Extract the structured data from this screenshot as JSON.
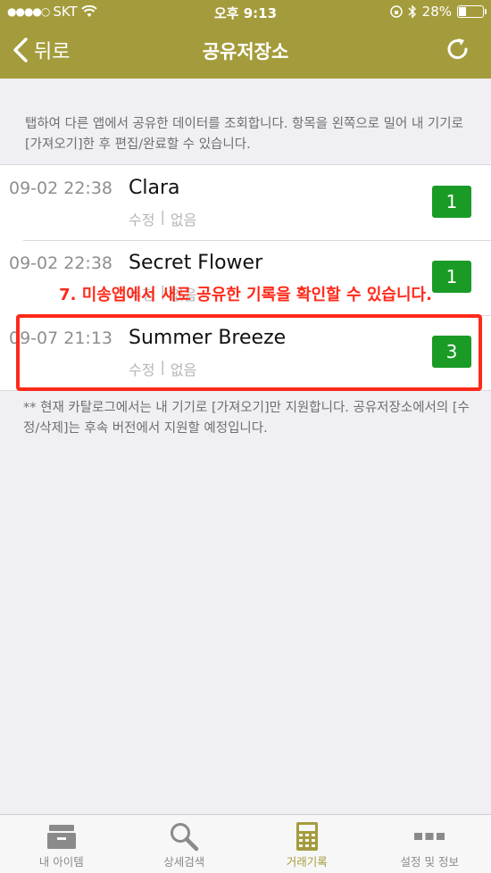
{
  "status_bar": {
    "carrier": "SKT",
    "time": "오후 9:13",
    "battery_percent": "28%",
    "battery_level": 0.28
  },
  "header": {
    "back_label": "뒤로",
    "title": "공유저장소"
  },
  "description": "탭하여 다른 앱에서 공유한 데이터를 조회합니다. 항목을 왼쪽으로 밀어 내 기기로 [가져오기]한 후 편집/완료할 수 있습니다.",
  "items": [
    {
      "time": "09-02 22:38",
      "name": "Clara",
      "edit_label": "수정",
      "separator": "|",
      "value": "없음",
      "count": "1"
    },
    {
      "time": "09-02 22:38",
      "name": "Secret Flower",
      "edit_label": "수정",
      "separator": "|",
      "value": "없음",
      "count": "1"
    },
    {
      "time": "09-07 21:13",
      "name": "Summer Breeze",
      "edit_label": "수정",
      "separator": "|",
      "value": "없음",
      "count": "3"
    }
  ],
  "annotation": "7. 미송앱에서 새로 공유한 기록을 확인할 수 있습니다.",
  "note": "** 현재 카탈로그에서는 내 기기로 [가져오기]만 지원합니다. 공유저장소에서의 [수정/삭제]는 후속 버전에서 지원할 예정입니다.",
  "tabs": [
    {
      "label": "내 아이템",
      "icon": "inbox-tray-icon"
    },
    {
      "label": "상세검색",
      "icon": "search-icon"
    },
    {
      "label": "거래기록",
      "icon": "calculator-icon",
      "active": true
    },
    {
      "label": "설정 및 정보",
      "icon": "more-dots-icon"
    }
  ],
  "colors": {
    "header": "#a49c3c",
    "badge": "#1a9b26",
    "annotation": "#ff2a1a"
  }
}
